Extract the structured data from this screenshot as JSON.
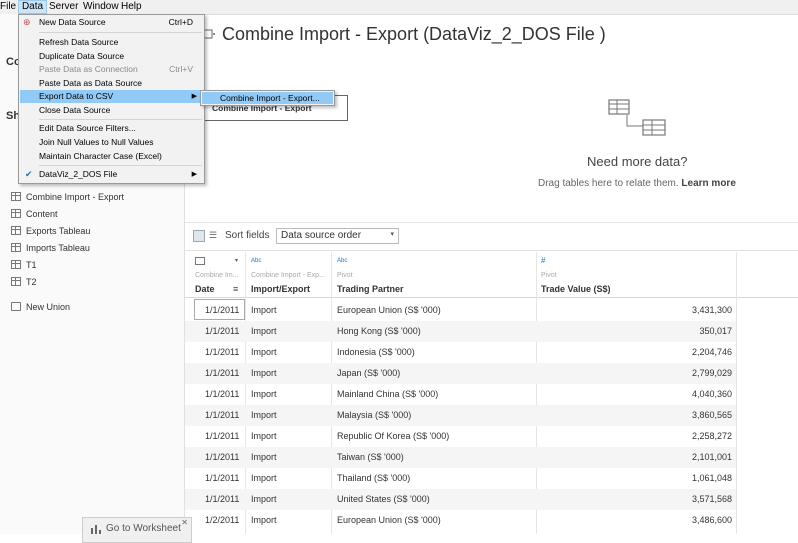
{
  "menubar": {
    "items": [
      "File",
      "Data",
      "Server",
      "Window",
      "Help"
    ]
  },
  "data_menu": {
    "items": [
      {
        "label": "New Data Source",
        "shortcut": "Ctrl+D",
        "disabled": false
      },
      {
        "label": "Refresh Data Source",
        "shortcut": "",
        "disabled": false
      },
      {
        "label": "Duplicate Data Source",
        "shortcut": "",
        "disabled": false
      },
      {
        "label": "Paste Data as Connection",
        "shortcut": "Ctrl+V",
        "disabled": true
      },
      {
        "label": "Paste Data as Data Source",
        "shortcut": "",
        "disabled": false
      },
      {
        "label": "Export Data to CSV",
        "shortcut": "",
        "disabled": false
      },
      {
        "label": "Close Data Source",
        "shortcut": "",
        "disabled": false
      },
      {
        "label": "Edit Data Source Filters...",
        "shortcut": "",
        "disabled": false
      },
      {
        "label": "Join Null Values to Null Values",
        "shortcut": "",
        "disabled": false
      },
      {
        "label": "Maintain Character Case (Excel)",
        "shortcut": "",
        "disabled": false
      },
      {
        "label": "DataViz_2_DOS File",
        "shortcut": "",
        "disabled": false
      }
    ],
    "submenu_item": "Combine Import -  Export..."
  },
  "sidebar": {
    "partial_co": "Co",
    "partial_sh": "Sh",
    "tables": [
      "Combine Import -  Export",
      "Content",
      "Exports Tableau",
      "Imports Tableau",
      "T1",
      "T2"
    ],
    "new_union": "New Union"
  },
  "canvas": {
    "title": "Combine Import -  Export (DataViz_2_DOS File )",
    "ds_box_label": "Combine Import - Export",
    "need_more": "Need more data?",
    "drag_text": "Drag tables here to relate them.",
    "learn_more": "Learn more"
  },
  "toolbar": {
    "sort_label": "Sort fields",
    "sort_value": "Data source order"
  },
  "grid": {
    "columns": [
      {
        "source": "Combine Im...",
        "name": "Date",
        "type": "date"
      },
      {
        "source": "Combine Import - Exp...",
        "name": "Import/Export",
        "type": "Abc"
      },
      {
        "source": "Pivot",
        "name": "Trading Partner",
        "type": "Abc"
      },
      {
        "source": "Pivot",
        "name": "Trade Value (S$)",
        "type": "#"
      }
    ],
    "rows": [
      [
        "1/1/2011",
        "Import",
        "European Union (S$ '000)",
        "3,431,300"
      ],
      [
        "1/1/2011",
        "Import",
        "Hong Kong (S$ '000)",
        "350,017"
      ],
      [
        "1/1/2011",
        "Import",
        "Indonesia (S$ '000)",
        "2,204,746"
      ],
      [
        "1/1/2011",
        "Import",
        "Japan (S$ '000)",
        "2,799,029"
      ],
      [
        "1/1/2011",
        "Import",
        "Mainland China (S$ '000)",
        "4,040,360"
      ],
      [
        "1/1/2011",
        "Import",
        "Malaysia (S$ '000)",
        "3,860,565"
      ],
      [
        "1/1/2011",
        "Import",
        "Republic Of Korea (S$ '000)",
        "2,258,272"
      ],
      [
        "1/1/2011",
        "Import",
        "Taiwan (S$ '000)",
        "2,101,001"
      ],
      [
        "1/1/2011",
        "Import",
        "Thailand (S$ '000)",
        "1,061,048"
      ],
      [
        "1/1/2011",
        "Import",
        "United States (S$ '000)",
        "3,571,568"
      ],
      [
        "1/2/2011",
        "Import",
        "European Union (S$ '000)",
        "3,486,600"
      ]
    ]
  },
  "goto_worksheet": "Go to Worksheet",
  "colors": {
    "accent": "#91c9f7",
    "type_icon": "#1f77b4"
  }
}
